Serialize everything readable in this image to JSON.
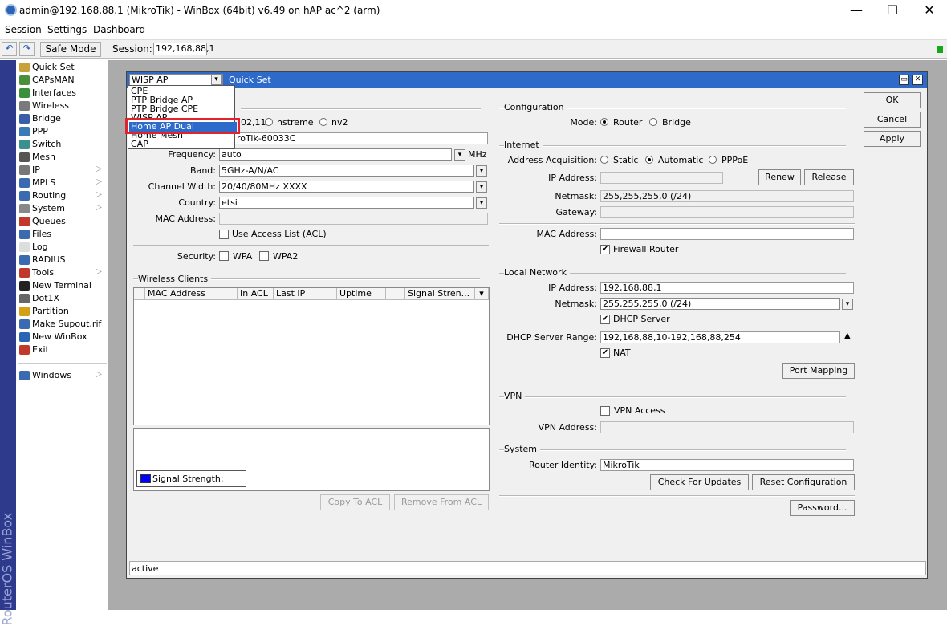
{
  "window": {
    "title": "admin@192.168.88.1 (MikroTik) - WinBox (64bit) v6.49 on hAP ac^2 (arm)",
    "minimize": "—",
    "maximize": "☐",
    "close": "✕"
  },
  "menubar": {
    "items": [
      "Session",
      "Settings",
      "Dashboard"
    ]
  },
  "toolbar": {
    "undo": "↶",
    "redo": "↷",
    "safe_mode": "Safe Mode",
    "session_label": "Session:",
    "session_value": "192,168,88,1"
  },
  "vbar_text": "RouterOS WinBox",
  "sidebar": {
    "items": [
      {
        "label": "Quick Set",
        "icon": "wand-icon",
        "color": "#c9a13a",
        "sub": false
      },
      {
        "label": "CAPsMAN",
        "icon": "capsman-icon",
        "color": "#4a8f3a",
        "sub": false
      },
      {
        "label": "Interfaces",
        "icon": "interfaces-icon",
        "color": "#3a8f3a",
        "sub": false
      },
      {
        "label": "Wireless",
        "icon": "wireless-icon",
        "color": "#7a7a7a",
        "sub": false
      },
      {
        "label": "Bridge",
        "icon": "bridge-icon",
        "color": "#3a5fa8",
        "sub": false
      },
      {
        "label": "PPP",
        "icon": "ppp-icon",
        "color": "#3a7ab8",
        "sub": false
      },
      {
        "label": "Switch",
        "icon": "switch-icon",
        "color": "#3a8f8f",
        "sub": false
      },
      {
        "label": "Mesh",
        "icon": "mesh-icon",
        "color": "#555555",
        "sub": false
      },
      {
        "label": "IP",
        "icon": "ip-icon",
        "color": "#777777",
        "sub": true
      },
      {
        "label": "MPLS",
        "icon": "mpls-icon",
        "color": "#3a6ab0",
        "sub": true
      },
      {
        "label": "Routing",
        "icon": "routing-icon",
        "color": "#3a6ab0",
        "sub": true
      },
      {
        "label": "System",
        "icon": "system-icon",
        "color": "#888888",
        "sub": true
      },
      {
        "label": "Queues",
        "icon": "queues-icon",
        "color": "#c0392b",
        "sub": false
      },
      {
        "label": "Files",
        "icon": "files-icon",
        "color": "#3a6ab0",
        "sub": false
      },
      {
        "label": "Log",
        "icon": "log-icon",
        "color": "#dddddd",
        "sub": false
      },
      {
        "label": "RADIUS",
        "icon": "radius-icon",
        "color": "#3a6ab0",
        "sub": false
      },
      {
        "label": "Tools",
        "icon": "tools-icon",
        "color": "#c0392b",
        "sub": true
      },
      {
        "label": "New Terminal",
        "icon": "terminal-icon",
        "color": "#222222",
        "sub": false
      },
      {
        "label": "Dot1X",
        "icon": "dot1x-icon",
        "color": "#666666",
        "sub": false
      },
      {
        "label": "Partition",
        "icon": "partition-icon",
        "color": "#d4a017",
        "sub": false
      },
      {
        "label": "Make Supout,rif",
        "icon": "supout-icon",
        "color": "#3a6ab0",
        "sub": false
      },
      {
        "label": "New WinBox",
        "icon": "winbox-icon",
        "color": "#2b64b5",
        "sub": false
      },
      {
        "label": "Exit",
        "icon": "exit-icon",
        "color": "#c0392b",
        "sub": false
      }
    ],
    "windows_item": {
      "label": "Windows",
      "icon": "windows-icon",
      "color": "#3a6ab0",
      "sub": true
    }
  },
  "quickset": {
    "title": "Quick Set",
    "mode_select": "WISP AP",
    "dropdown_options": [
      "CPE",
      "PTP Bridge AP",
      "PTP Bridge CPE",
      "WISP AP",
      "Home AP Dual",
      "Home Mesh",
      "CAP"
    ],
    "dropdown_selected": "Home AP Dual",
    "protocol_prefix": "02,11",
    "protocol_nstreme": "nstreme",
    "protocol_nv2": "nv2",
    "ssid_value": "roTik-60033C",
    "frequency_label": "Frequency:",
    "frequency_value": "auto",
    "frequency_unit": "MHz",
    "band_label": "Band:",
    "band_value": "5GHz-A/N/AC",
    "channel_width_label": "Channel Width:",
    "channel_width_value": "20/40/80MHz XXXX",
    "country_label": "Country:",
    "country_value": "etsi",
    "mac_label": "MAC Address:",
    "mac_value": "",
    "use_acl_label": "Use Access List (ACL)",
    "security_label": "Security:",
    "wpa_label": "WPA",
    "wpa2_label": "WPA2",
    "wireless_clients_title": "Wireless Clients",
    "clients_columns": [
      "MAC Address",
      "In ACL",
      "Last IP",
      "Uptime",
      "Signal Stren..."
    ],
    "signal_strength_label": "Signal Strength:",
    "signal_color": "#0000ff",
    "copy_to_acl": "Copy To ACL",
    "remove_from_acl": "Remove From ACL",
    "status": "active"
  },
  "config": {
    "title": "Configuration",
    "mode_label": "Mode:",
    "router": "Router",
    "bridge": "Bridge",
    "internet_title": "Internet",
    "addr_acq_label": "Address Acquisition:",
    "static": "Static",
    "automatic": "Automatic",
    "pppoe": "PPPoE",
    "ip_label": "IP Address:",
    "ip_value": "",
    "renew": "Renew",
    "release": "Release",
    "netmask_label": "Netmask:",
    "netmask_value": "255,255,255,0 (/24)",
    "gateway_label": "Gateway:",
    "gateway_value": "",
    "mac_label": "MAC Address:",
    "mac_value": "",
    "firewall_router": "Firewall Router",
    "local_title": "Local Network",
    "local_ip_label": "IP Address:",
    "local_ip_value": "192,168,88,1",
    "local_netmask_label": "Netmask:",
    "local_netmask_value": "255,255,255,0 (/24)",
    "dhcp_server": "DHCP Server",
    "dhcp_range_label": "DHCP Server Range:",
    "dhcp_range_value": "192,168,88,10-192,168,88,254",
    "nat": "NAT",
    "port_mapping": "Port Mapping",
    "vpn_title": "VPN",
    "vpn_access": "VPN Access",
    "vpn_address_label": "VPN Address:",
    "vpn_address_value": "",
    "system_title": "System",
    "identity_label": "Router Identity:",
    "identity_value": "MikroTik",
    "check_updates": "Check For Updates",
    "reset_config": "Reset Configuration",
    "password": "Password..."
  },
  "actions": {
    "ok": "OK",
    "cancel": "Cancel",
    "apply": "Apply"
  }
}
